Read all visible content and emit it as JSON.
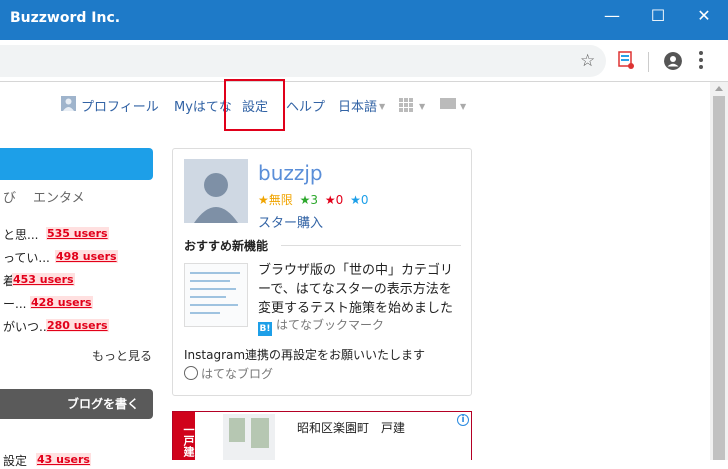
{
  "window": {
    "title": "Buzzword Inc.",
    "minimize": "—",
    "maximize": "☐",
    "close": "✕"
  },
  "browser": {
    "bookmark_icon": "star-icon",
    "star_glyph": "☆"
  },
  "nav": {
    "profile": "プロフィール",
    "my_hatena": "Myはてな",
    "settings": "設定",
    "help": "ヘルプ",
    "language": "日本語"
  },
  "left": {
    "categories": [
      "び",
      "エンタメ"
    ],
    "entries": [
      {
        "text": "と思...",
        "users": "535 users"
      },
      {
        "text": "ってい...",
        "users": "498 users"
      },
      {
        "text": "着",
        "users": "453 users"
      },
      {
        "text": "ー...",
        "users": "428 users"
      },
      {
        "text": "がいつ...",
        "users": "280 users"
      },
      {
        "text": "設定",
        "users": "43 users"
      }
    ],
    "more": "もっと見る",
    "write_blog": "ブログを書く"
  },
  "profile_card": {
    "username": "buzzjp",
    "stars": {
      "yellow": "★無限",
      "green": "★3",
      "red": "★0",
      "blue": "★0"
    },
    "buy_stars": "スター購入",
    "recommended_title": "おすすめ新機能",
    "article": "ブラウザ版の「世の中」カテゴリーで、はてなスターの表示方法を変更するテスト施策を始めました",
    "article_source": "はてなブックマーク",
    "b_badge": "B!",
    "notice": "Instagram連携の再設定をお願いいたします",
    "notice_source": "はてなブログ"
  },
  "ad": {
    "red_label": "一戸建",
    "text": "昭和区楽園町　戸建",
    "info": "i"
  },
  "colors": {
    "titlebar": "#1e7ac8",
    "link": "#3263a5",
    "highlight": "#e0001a",
    "blue_bar": "#1d9fe8"
  }
}
